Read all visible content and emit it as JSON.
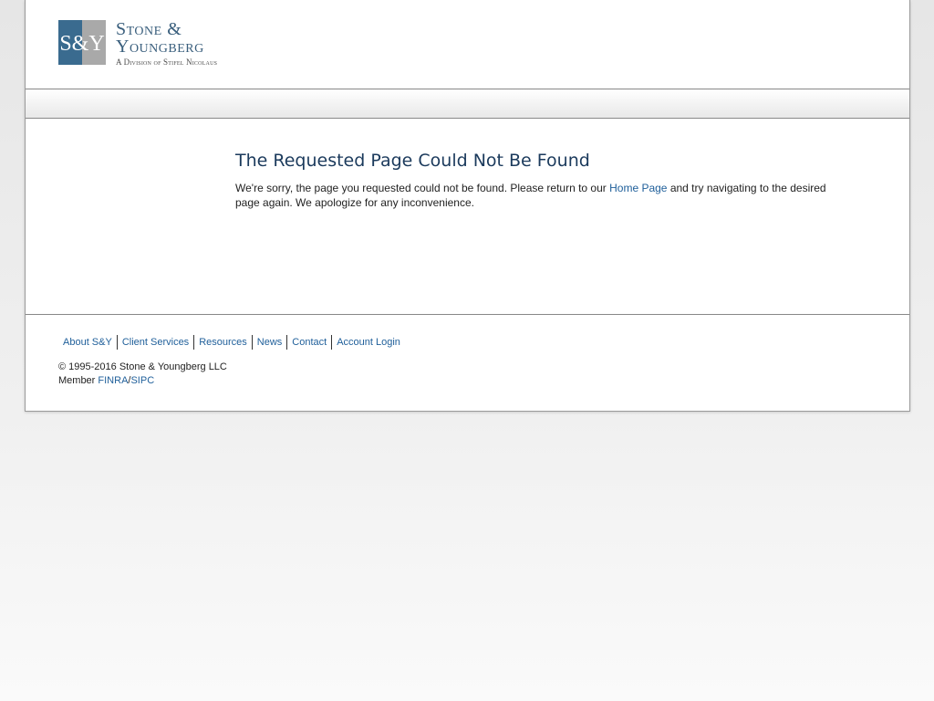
{
  "brand": {
    "logo_monogram": "S&Y",
    "name_line1": "Stone &",
    "name_line2": "Youngberg",
    "tagline": "A Division of Stifel Nicolaus",
    "colors": {
      "logo_blue": "#3a6b8f",
      "logo_gray": "#a9a9a9",
      "text": "#3a5f7d"
    }
  },
  "main": {
    "title": "The Requested Page Could Not Be Found",
    "message_before": "We're sorry, the page you requested could not be found. Please return to our ",
    "home_link": "Home Page",
    "message_after": " and try navigating to the desired page again. We apologize for any inconvenience."
  },
  "footer": {
    "nav": [
      "About S&Y",
      "Client Services",
      "Resources",
      "News",
      "Contact",
      "Account Login"
    ],
    "copyright": "© 1995-2016 Stone & Youngberg LLC",
    "member_label": "Member ",
    "finra_link": "FINRA",
    "separator": "/",
    "sipc_link": "SIPC"
  },
  "colors": {
    "title": "#1b3a5c",
    "link": "#1f5f9a"
  }
}
